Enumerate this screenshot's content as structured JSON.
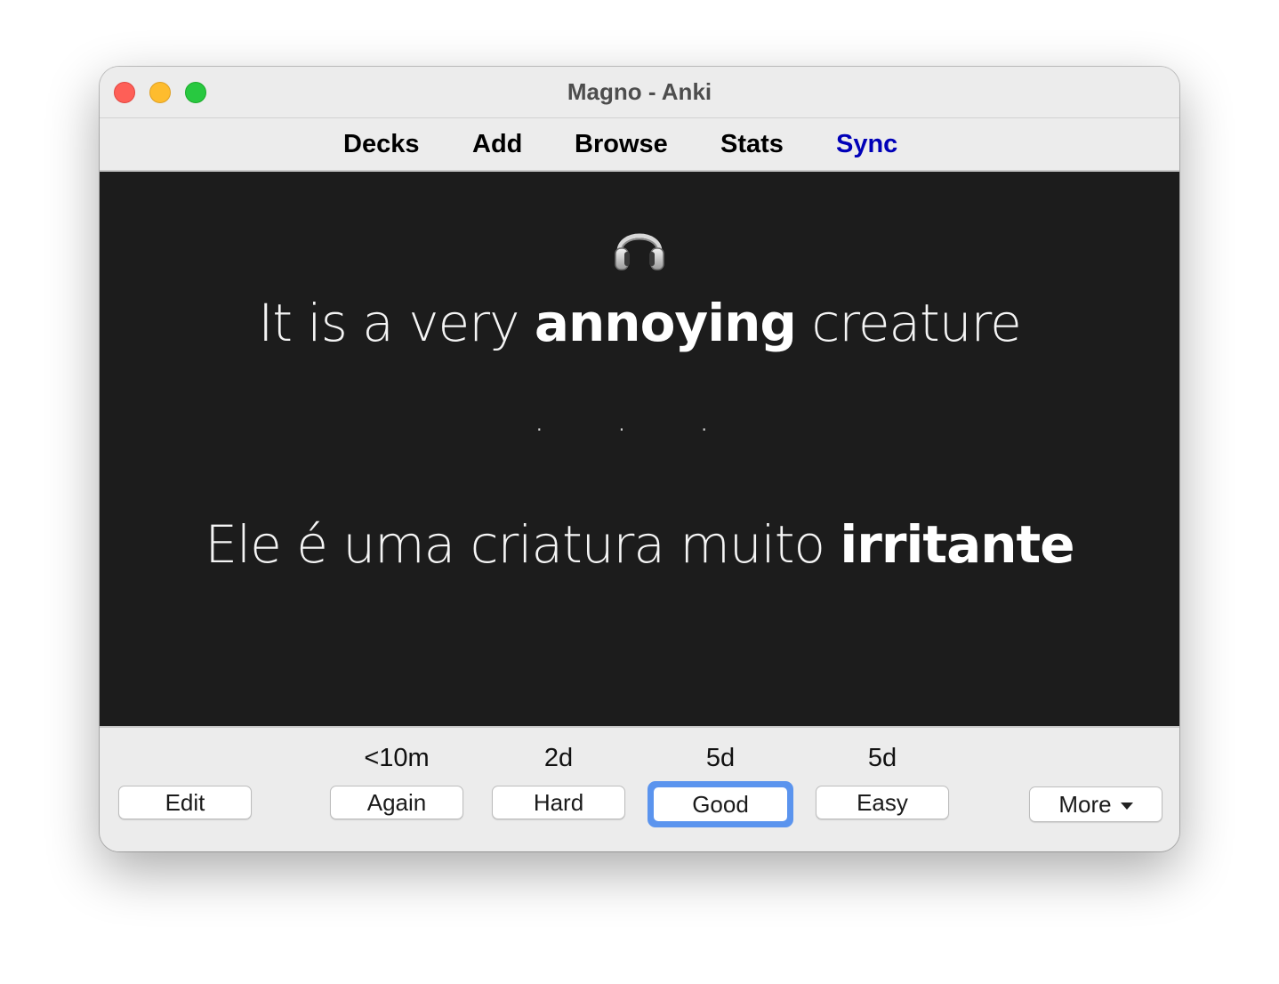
{
  "window": {
    "title": "Magno - Anki"
  },
  "toolbar": {
    "items": [
      {
        "label": "Decks"
      },
      {
        "label": "Add"
      },
      {
        "label": "Browse"
      },
      {
        "label": "Stats"
      },
      {
        "label": "Sync"
      }
    ],
    "sync_color": "#0000b8"
  },
  "card": {
    "audio_icon": "headphones-icon",
    "front": {
      "before": "It is a very ",
      "bold": "annoying",
      "after": " creature"
    },
    "divider": "· · ·",
    "back": {
      "before": "Ele é uma criatura muito ",
      "bold": "irritante",
      "after": ""
    },
    "background": "#1c1c1c"
  },
  "answer_bar": {
    "edit_label": "Edit",
    "buttons": [
      {
        "interval": "<10m",
        "label": "Again"
      },
      {
        "interval": "2d",
        "label": "Hard"
      },
      {
        "interval": "5d",
        "label": "Good"
      },
      {
        "interval": "5d",
        "label": "Easy"
      }
    ],
    "focused_button": "Good",
    "more_label": "More",
    "focus_color": "#5b94ee"
  }
}
